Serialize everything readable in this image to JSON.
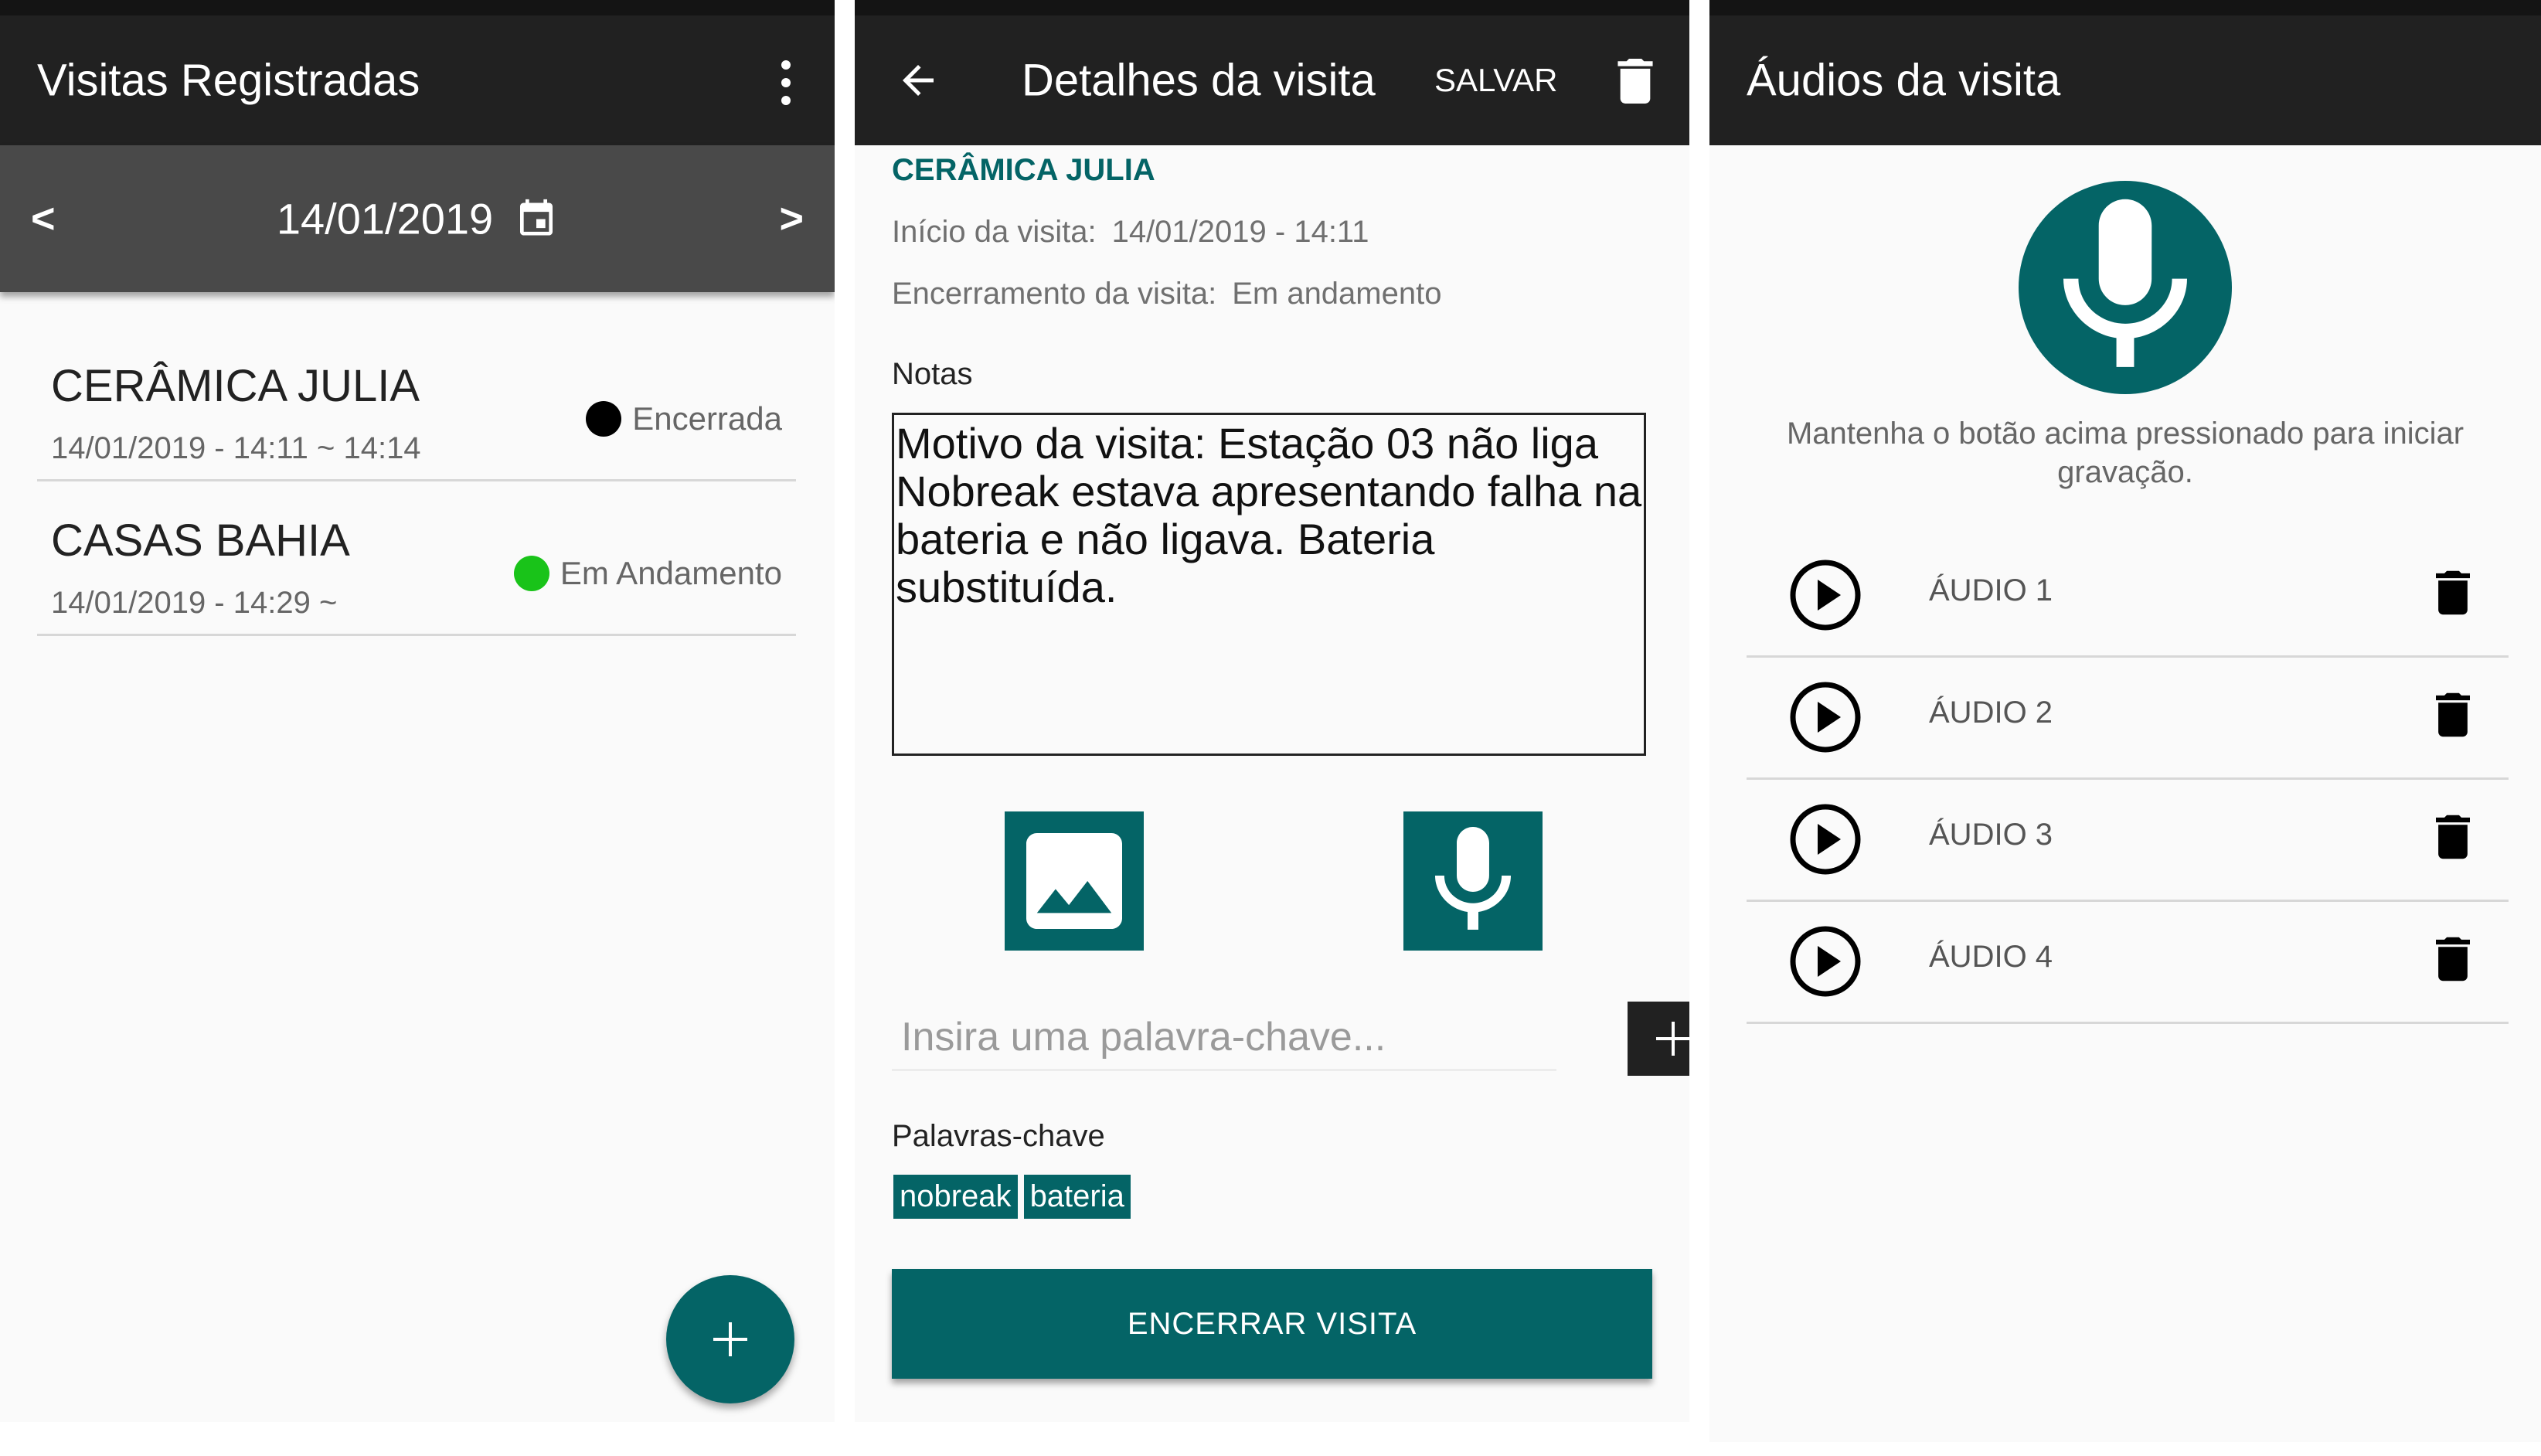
{
  "screen1": {
    "title": "Visitas Registradas",
    "menu_icon": "more-vert-icon",
    "date_nav": {
      "prev": "<",
      "date": "14/01/2019",
      "next": ">",
      "calendar_icon": "calendar-icon"
    },
    "visits": [
      {
        "name": "CERÂMICA JULIA",
        "time": "14/01/2019 - 14:11 ~ 14:14",
        "status": "Encerrada",
        "status_color": "#000000"
      },
      {
        "name": "CASAS BAHIA",
        "time": "14/01/2019 - 14:29 ~",
        "status": "Em Andamento",
        "status_color": "#19c319"
      }
    ],
    "fab_icon": "plus-icon"
  },
  "screen2": {
    "title": "Detalhes da visita",
    "save": "SALVAR",
    "company": "CERÂMICA JULIA",
    "start_label": "Início da visita:",
    "start_value": "14/01/2019 - 14:11",
    "end_label": "Encerramento da visita:",
    "end_value": "Em andamento",
    "notes_label": "Notas",
    "notes": [
      "Motivo da visita: Estação 03 não liga",
      "Nobreak estava apresentando falha na",
      "bateria e não ligava. Bateria substituída."
    ],
    "keyword_placeholder": "Insira uma palavra-chave...",
    "keywords_label": "Palavras-chave",
    "keywords": [
      "nobreak",
      "bateria"
    ],
    "end_button": "ENCERRAR VISITA",
    "accent_color": "#046466"
  },
  "screen3": {
    "title": "Áudios da visita",
    "hint": "Mantenha o botão acima pressionado para iniciar gravação.",
    "audios": [
      "ÁUDIO 1",
      "ÁUDIO 2",
      "ÁUDIO 3",
      "ÁUDIO 4"
    ]
  }
}
